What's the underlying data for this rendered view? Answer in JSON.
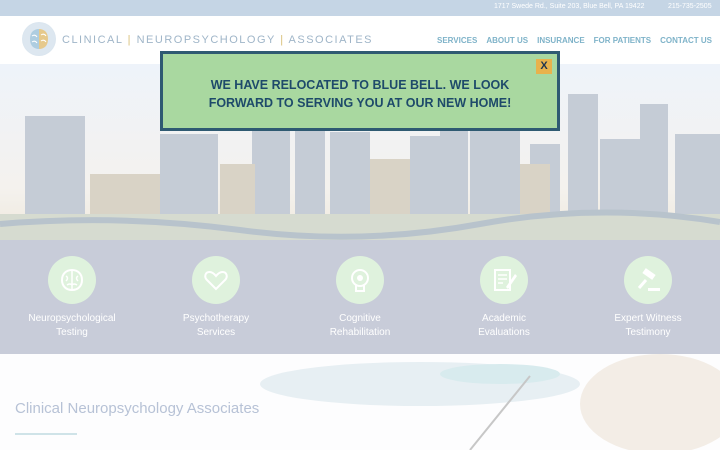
{
  "topbar": {
    "address": "1717 Swede Rd., Suite 203, Blue Bell, PA 19422",
    "phone": "215-735-2505"
  },
  "logo": {
    "part1": "CLINICAL",
    "part2": "NEUROPSYCHOLOGY",
    "part3": "ASSOCIATES",
    "separator": "|"
  },
  "nav": {
    "items": [
      {
        "label": "SERVICES"
      },
      {
        "label": "ABOUT US"
      },
      {
        "label": "INSURANCE"
      },
      {
        "label": "FOR PATIENTS"
      },
      {
        "label": "CONTACT US"
      }
    ]
  },
  "modal": {
    "line1": "WE HAVE RELOCATED TO BLUE BELL. WE LOOK",
    "line2": "FORWARD TO SERVING YOU AT OUR NEW HOME!",
    "close_label": "X"
  },
  "services": {
    "items": [
      {
        "line1": "Neuropsychological",
        "line2": "Testing",
        "icon": "brain-icon"
      },
      {
        "line1": "Psychotherapy",
        "line2": "Services",
        "icon": "heart-icon"
      },
      {
        "line1": "Cognitive",
        "line2": "Rehabilitation",
        "icon": "head-gears-icon"
      },
      {
        "line1": "Academic",
        "line2": "Evaluations",
        "icon": "document-pen-icon"
      },
      {
        "line1": "Expert Witness",
        "line2": "Testimony",
        "icon": "gavel-icon"
      }
    ]
  },
  "lower": {
    "title": "Clinical Neuropsychology Associates"
  },
  "colors": {
    "modal_bg": "#a9d8a0",
    "modal_border": "#2f5a72",
    "close_bg": "#e8b24c",
    "nav_text": "#7fb3c9",
    "services_bg": "#c8ccd9"
  }
}
